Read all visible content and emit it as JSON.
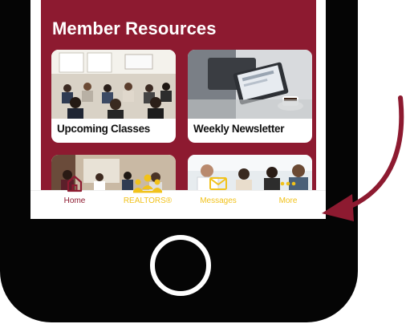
{
  "section": {
    "title": "Member Resources"
  },
  "cards": [
    {
      "label": "Upcoming Classes"
    },
    {
      "label": "Weekly Newsletter"
    },
    {
      "label": ""
    },
    {
      "label": ""
    }
  ],
  "tabs": [
    {
      "label": "Home",
      "icon": "home-icon"
    },
    {
      "label": "REALTORS®",
      "icon": "people-icon"
    },
    {
      "label": "Messages",
      "icon": "envelope-icon"
    },
    {
      "label": "More",
      "icon": "ellipsis-icon"
    }
  ],
  "colors": {
    "brand_maroon": "#8d1a30",
    "tab_gold": "#f1c21b",
    "phone_black": "#050505"
  }
}
